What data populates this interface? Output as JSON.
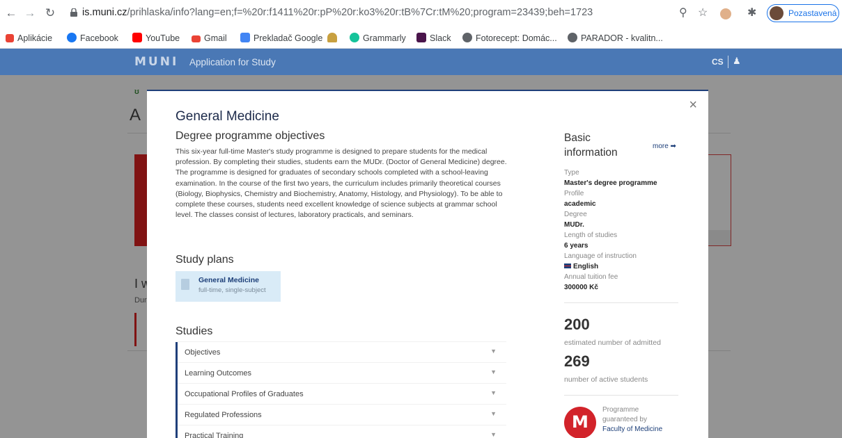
{
  "browser": {
    "url_domain": "is.muni.cz",
    "url_rest": "/prihlaska/info?lang=en;f=%20r:f1411%20r:pP%20r:ko3%20r:tB%7Cr:tM%20;program=23439;beh=1723",
    "profile_label": "Pozastavená",
    "bookmarks": [
      "Aplikácie",
      "Facebook",
      "YouTube",
      "Gmail",
      "Prekladač Google",
      "",
      "Grammarly",
      "Slack",
      "Fotorecept: Domác...",
      "PARADOR - kvalitn..."
    ]
  },
  "site": {
    "logo": "MUNI",
    "app_title": "Application for Study",
    "lang": "CS"
  },
  "background": {
    "title": "A",
    "iw": "I w",
    "dur": "Dur"
  },
  "modal": {
    "title": "General Medicine",
    "objectives_heading": "Degree programme objectives",
    "description": "This six-year full-time Master's study programme is designed to prepare students for the medical profession. By completing their studies, students earn the MUDr. (Doctor of General Medicine) degree. The programme is designed for graduates of secondary schools completed with a school-leaving examination. In the course of the first two years, the curriculum includes primarily theoretical courses (Biology, Biophysics, Chemistry and Biochemistry, Anatomy, Histology, and Physiology). To be able to complete these courses, students need excellent knowledge of science subjects at grammar school level. The classes consist of lectures, laboratory practicals, and seminars.",
    "study_plans_heading": "Study plans",
    "plan": {
      "title": "General Medicine",
      "subtitle": "full-time, single-subject"
    },
    "studies_heading": "Studies",
    "studies_items": [
      "Objectives",
      "Learning Outcomes",
      "Occupational Profiles of Graduates",
      "Regulated Professions",
      "Practical Training"
    ],
    "basic_info_heading": "Basic information",
    "more_label": "more ➡",
    "info": {
      "type_label": "Type",
      "type_value": "Master's degree programme",
      "profile_label": "Profile",
      "profile_value": "academic",
      "degree_label": "Degree",
      "degree_value": "MUDr.",
      "length_label": "Length of studies",
      "length_value": "6 years",
      "language_label": "Language of instruction",
      "language_value": "English",
      "fee_label": "Annual tuition fee",
      "fee_value": "300000 Kč"
    },
    "admitted_count": "200",
    "admitted_caption": "estimated number of admitted",
    "active_count": "269",
    "active_caption": "number of active students",
    "guarantee_line1": "Programme",
    "guarantee_line2": "guaranteed by",
    "guarantee_faculty": "Faculty of Medicine"
  },
  "colors": {
    "header": "#4a78b5",
    "modal_accent": "#1f3f7a",
    "faculty_red": "#d2232a"
  }
}
